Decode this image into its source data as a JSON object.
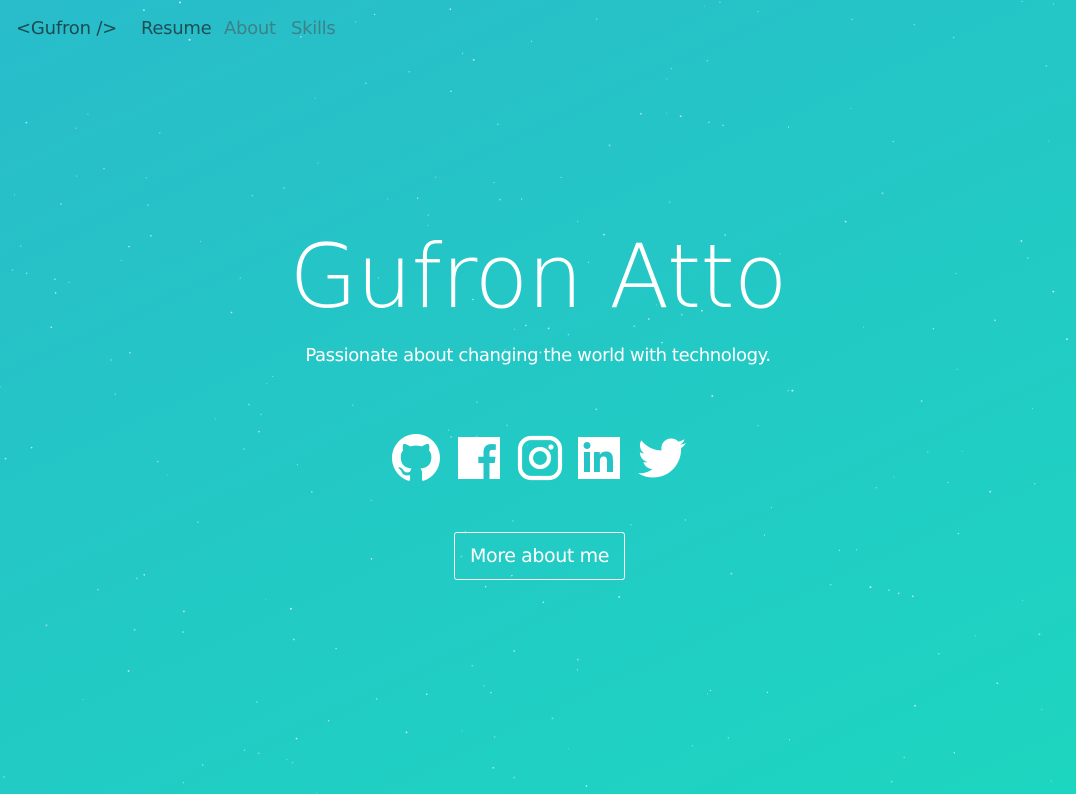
{
  "nav": {
    "brand": "<Gufron />",
    "links": [
      "Resume",
      "About",
      "Skills"
    ]
  },
  "hero": {
    "name": "Gufron Atto",
    "tagline": "Passionate about changing the world with technology.",
    "cta_label": "More about me"
  },
  "social": [
    {
      "network": "GitHub",
      "icon": "github-icon"
    },
    {
      "network": "Facebook",
      "icon": "facebook-icon"
    },
    {
      "network": "Instagram",
      "icon": "instagram-icon"
    },
    {
      "network": "LinkedIn",
      "icon": "linkedin-icon"
    },
    {
      "network": "Twitter",
      "icon": "twitter-icon"
    }
  ],
  "colors": {
    "background_start": "#29bcca",
    "background_end": "#1dd6c0",
    "text": "#ffffff",
    "nav_active": "#1e4f57",
    "nav_inactive": "#3d8288"
  }
}
